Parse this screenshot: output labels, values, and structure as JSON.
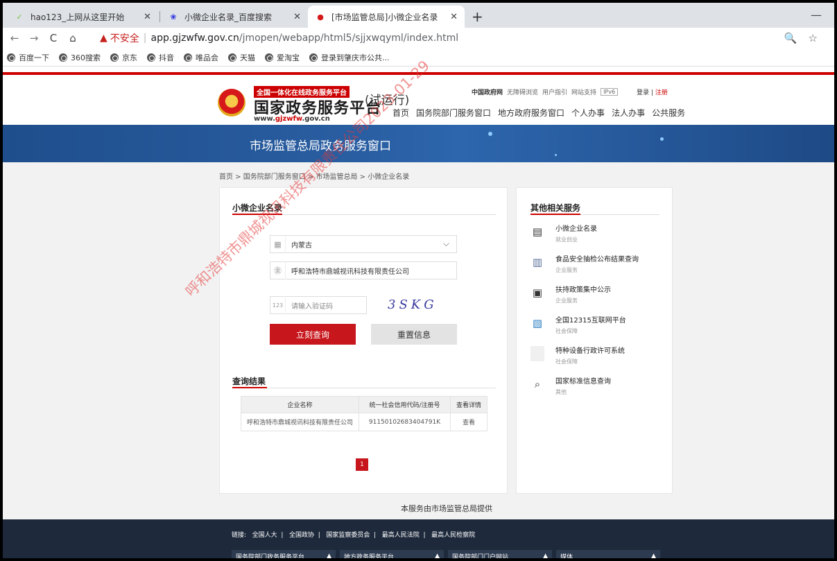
{
  "browser": {
    "tabs": [
      {
        "label": "hao123_上网从这里开始",
        "icon": "hao123-icon",
        "active": false
      },
      {
        "label": "小微企业名录_百度搜索",
        "icon": "baidu-paw-icon",
        "active": false
      },
      {
        "label": "[市场监管总局]小微企业名录",
        "icon": "emblem-icon",
        "active": true
      }
    ],
    "nav_back": "←",
    "nav_forward": "→",
    "nav_reload": "C",
    "nav_home": "⌂",
    "security_warning": "▲",
    "security_label": "不安全",
    "url_separator": "|",
    "url_domain": "app.gjzwfw.gov.cn",
    "url_path": "/jmopen/webapp/html5/sjjxwqyml/index.html",
    "right_icons": "🔍☆",
    "bookmarks": [
      "百度一下",
      "360搜索",
      "京东",
      "抖音",
      "唯品会",
      "天猫",
      "爱淘宝",
      "登录到肇庆市公共..."
    ]
  },
  "header": {
    "badge": "全国一体化在线政务服务平台",
    "site_name": "国家政务服务平台",
    "site_url_prefix": "www.",
    "site_url_brand": "gjzwfw",
    "site_url_suffix": ".gov.cn",
    "trial": "(试运行)",
    "top_links": {
      "gov": "中国政府网",
      "accessible": "无障碍浏览",
      "guide": "用户指引",
      "support": "网站支持",
      "ipv6": "IPv6"
    },
    "login": "登录",
    "login_sep": "|",
    "register": "注册",
    "nav": [
      "首页",
      "国务院部门服务窗口",
      "地方政府服务窗口",
      "个人办事",
      "法人办事",
      "公共服务"
    ]
  },
  "banner": {
    "title": "市场监管总局政务服务窗口"
  },
  "breadcrumb": "首页 > 国务院部门服务窗口 > 市场监管总局 > 小微企业名录",
  "search": {
    "section_title": "小微企业名录",
    "region_value": "内蒙古",
    "company_value": "呼和浩特市鼎城视讯科技有限责任公司",
    "captcha_placeholder": "请输入验证码",
    "captcha_icon_text": "123",
    "captcha_text": "3SKG",
    "submit_label": "立刻查询",
    "reset_label": "重置信息"
  },
  "results": {
    "section_title": "查询结果",
    "columns": [
      "企业名称",
      "统一社会信用代码/注册号",
      "查看详情"
    ],
    "rows": [
      {
        "name": "呼和浩特市鼎城视讯科技有限责任公司",
        "code": "91150102683404791K",
        "action": "查看"
      }
    ],
    "current_page": "1"
  },
  "related": {
    "section_title": "其他相关服务",
    "items": [
      {
        "name": "小微企业名录",
        "category": "就业创业",
        "icon": "list-book-icon"
      },
      {
        "name": "食品安全抽检公布结果查询",
        "category": "企业服务",
        "icon": "building-icon"
      },
      {
        "name": "扶持政策集中公示",
        "category": "企业服务",
        "icon": "open-book-icon"
      },
      {
        "name": "全国12315互联网平台",
        "category": "社会保障",
        "icon": "monitor-chart-icon"
      },
      {
        "name": "特种设备行政许可系统",
        "category": "社会保障",
        "icon": "blank-icon"
      },
      {
        "name": "国家标准信息查询",
        "category": "其他",
        "icon": "search-document-icon"
      }
    ]
  },
  "provided_by": "本服务由市场监管总局提供",
  "footer": {
    "links_label": "链接:",
    "links": [
      "全国人大",
      "全国政协",
      "国家监察委员会",
      "最高人民法院",
      "最高人民检察院"
    ],
    "selects": [
      "国务院部门政务服务平台",
      "地方政务服务平台",
      "国务院部门门户网站",
      "媒体"
    ]
  },
  "watermark": "呼和浩特市鼎城视讯科技有限责任公司2023-01-29",
  "colors": {
    "accent_red": "#c7161c",
    "banner_blue": "#2a5fa3",
    "footer_navy": "#1e2a3c"
  }
}
